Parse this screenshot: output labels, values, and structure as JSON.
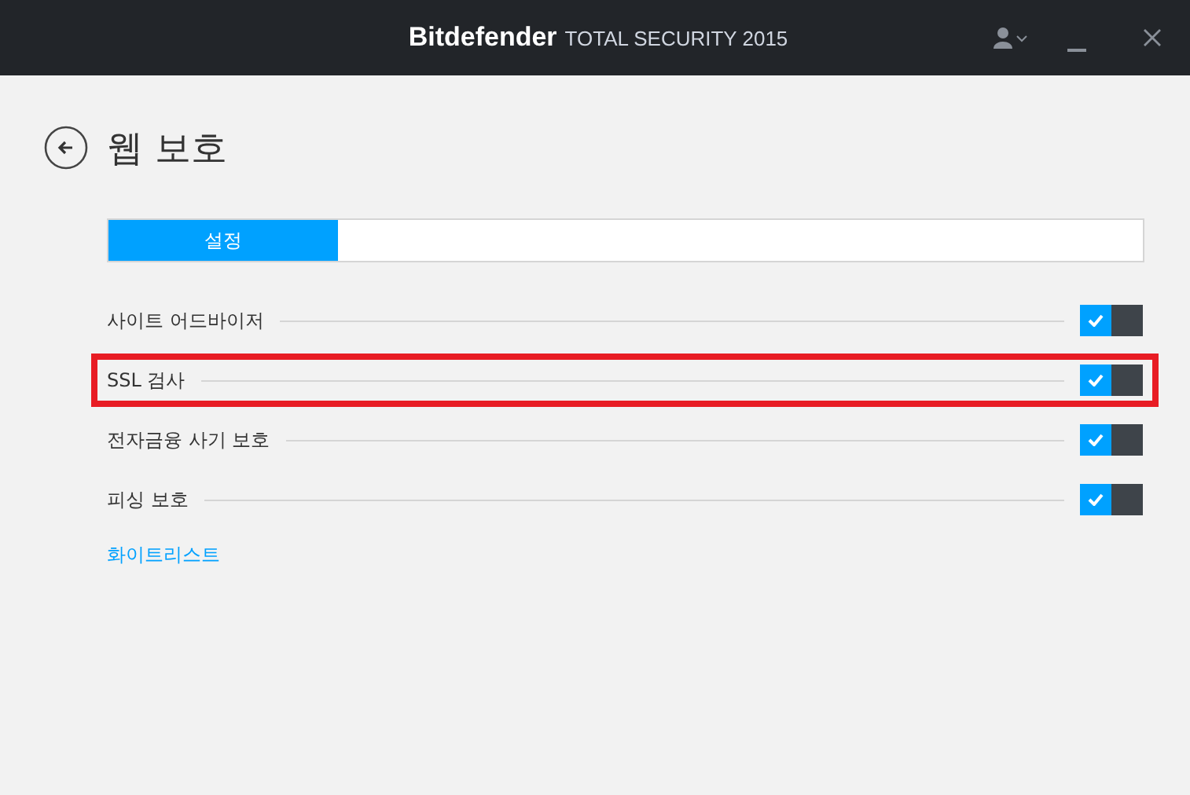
{
  "window": {
    "brand": "Bitdefender",
    "product": "TOTAL SECURITY 2015"
  },
  "page": {
    "title": "웹 보호"
  },
  "tabs": [
    {
      "label": "설정",
      "selected": true
    }
  ],
  "settings": [
    {
      "label": "사이트 어드바이저",
      "on": true,
      "highlighted": false
    },
    {
      "label": "SSL 검사",
      "on": true,
      "highlighted": true
    },
    {
      "label": "전자금융 사기 보호",
      "on": true,
      "highlighted": false
    },
    {
      "label": "피싱 보호",
      "on": true,
      "highlighted": false
    }
  ],
  "link": "화이트리스트"
}
